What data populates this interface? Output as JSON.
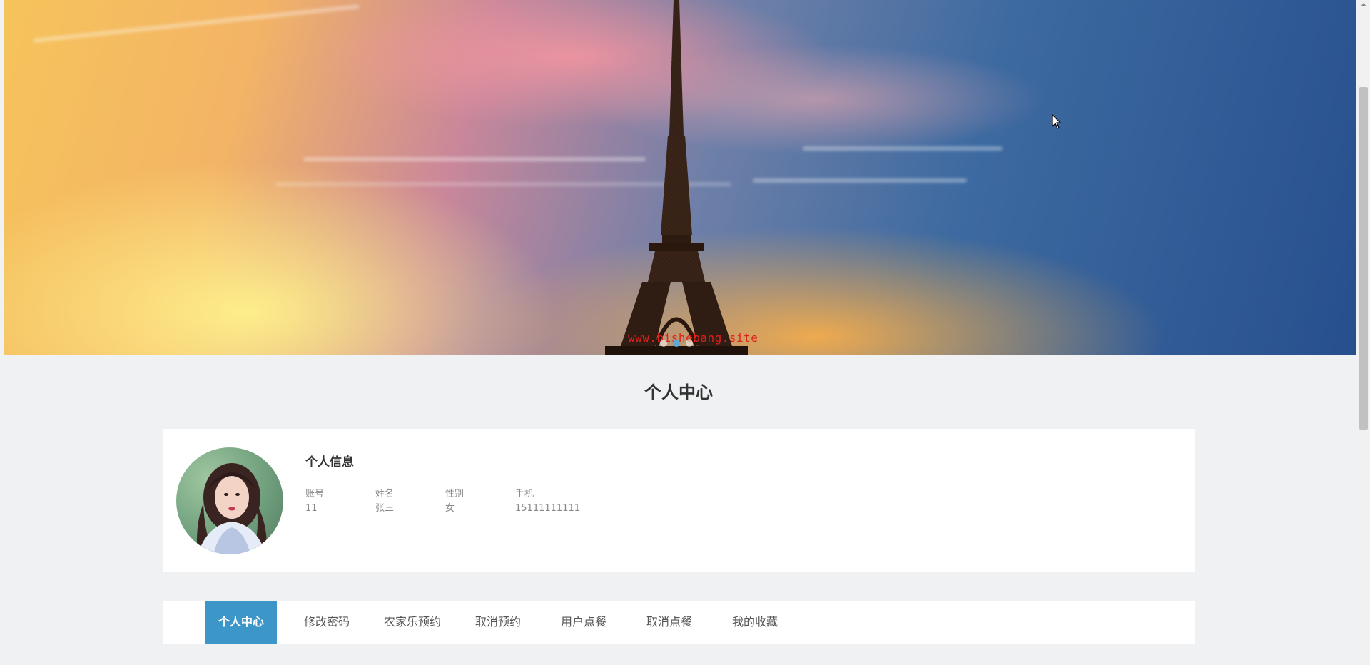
{
  "banner": {
    "watermark": "www.bishebang.site",
    "slide_count": 3,
    "active_slide": 2
  },
  "profile": {
    "section_title": "个人中心",
    "info_title": "个人信息",
    "fields": [
      {
        "label": "账号",
        "value": "11"
      },
      {
        "label": "姓名",
        "value": "张三"
      },
      {
        "label": "性别",
        "value": "女"
      },
      {
        "label": "手机",
        "value": "15111111111"
      }
    ]
  },
  "tabs": [
    {
      "label": "个人中心",
      "active": true
    },
    {
      "label": "修改密码",
      "active": false
    },
    {
      "label": "农家乐预约",
      "active": false
    },
    {
      "label": "取消预约",
      "active": false
    },
    {
      "label": "用户点餐",
      "active": false
    },
    {
      "label": "取消点餐",
      "active": false
    },
    {
      "label": "我的收藏",
      "active": false
    }
  ],
  "colors": {
    "accent": "#3c97c8",
    "page_bg": "#f0f1f2",
    "watermark": "#e0201c"
  }
}
